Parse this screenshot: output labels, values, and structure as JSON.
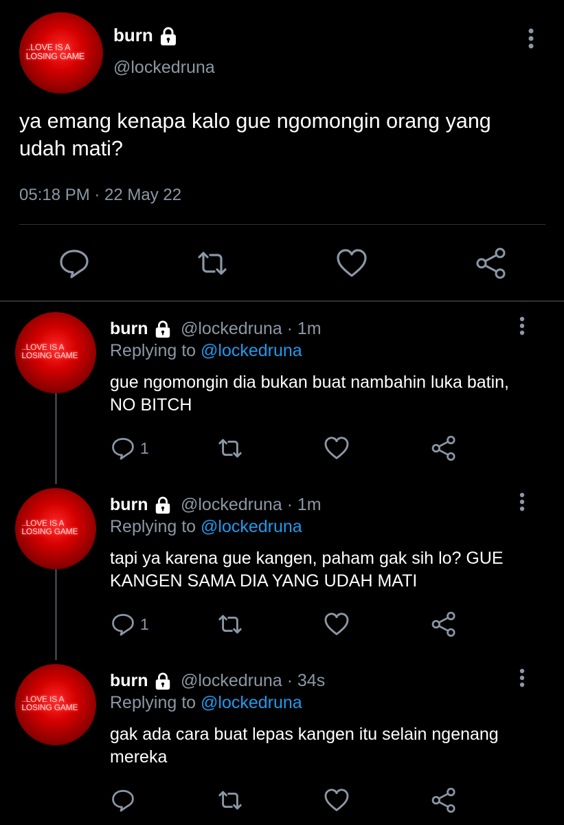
{
  "main_tweet": {
    "avatar_line1": "..LOVE IS A",
    "avatar_line2": "LOSING GAME",
    "display_name": "burn",
    "handle": "@lockedruna",
    "text": "ya emang kenapa kalo gue ngomongin orang yang udah mati?",
    "timestamp": "05:18 PM · 22 May 22"
  },
  "replies": [
    {
      "display_name": "burn",
      "handle_time": "@lockedruna · 1m",
      "replying_prefix": "Replying to",
      "replying_to": "@lockedruna",
      "text": "gue ngomongin dia bukan buat nambahin luka batin, NO BITCH",
      "reply_count": "1"
    },
    {
      "display_name": "burn",
      "handle_time": "@lockedruna · 1m",
      "replying_prefix": "Replying to",
      "replying_to": "@lockedruna",
      "text": "tapi ya karena gue kangen, paham gak sih lo? GUE KANGEN SAMA DIA YANG UDAH MATI",
      "reply_count": "1"
    },
    {
      "display_name": "burn",
      "handle_time": "@lockedruna · 34s",
      "replying_prefix": "Replying to",
      "replying_to": "@lockedruna",
      "text": "gak ada cara buat lepas kangen itu selain ngenang mereka",
      "reply_count": ""
    }
  ],
  "icons": {
    "reply": "reply-icon",
    "retweet": "retweet-icon",
    "like": "heart-icon",
    "share": "share-icon",
    "more": "more-vertical-icon",
    "lock": "lock-icon"
  },
  "colors": {
    "background": "#000000",
    "text": "#e7e9ea",
    "secondary": "#8b98a5",
    "link": "#1d9bf0",
    "divider": "#2f3336"
  }
}
